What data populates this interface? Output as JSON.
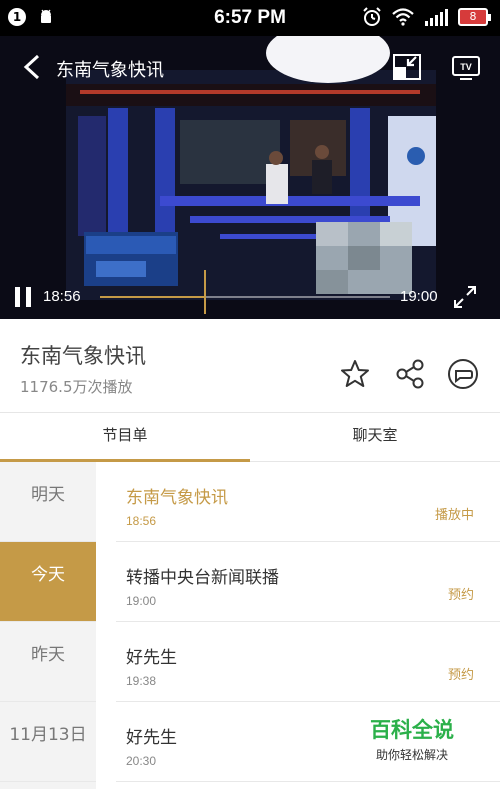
{
  "status_bar": {
    "time": "6:57 PM",
    "notification_badge": "1",
    "battery": "8"
  },
  "player": {
    "title": "东南气象快讯",
    "current_time": "18:56",
    "end_time": "19:00",
    "progress": 0.36
  },
  "info": {
    "title": "东南气象快讯",
    "play_count": "1176.5万次播放"
  },
  "tabs": [
    {
      "label": "节目单",
      "active": true
    },
    {
      "label": "聊天室",
      "active": false
    }
  ],
  "days": [
    {
      "label": "明天",
      "active": false
    },
    {
      "label": "今天",
      "active": true
    },
    {
      "label": "昨天",
      "active": false
    },
    {
      "label": "11月13日",
      "active": false
    }
  ],
  "programs": [
    {
      "name": "东南气象快讯",
      "time": "18:56",
      "status": "播放中",
      "current": true
    },
    {
      "name": "转播中央台新闻联播",
      "time": "19:00",
      "status": "预约",
      "current": false
    },
    {
      "name": "好先生",
      "time": "19:38",
      "status": "预约",
      "current": false
    },
    {
      "name": "好先生",
      "time": "20:30",
      "status": "",
      "current": false
    }
  ],
  "watermark": {
    "main": "百科全说",
    "sub": "助你轻松解决"
  },
  "colors": {
    "accent": "#c59a47",
    "status_bar_bg": "#000000",
    "day_active_bg": "#c59a47",
    "day_list_bg": "#f3f3f3"
  }
}
